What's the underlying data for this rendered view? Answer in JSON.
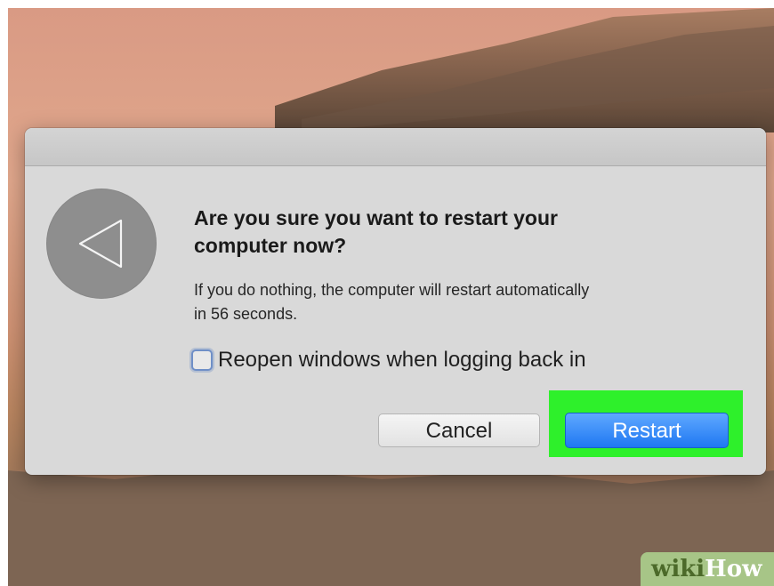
{
  "dialog": {
    "heading": "Are you sure you want to restart your\ncomputer now?",
    "message": "If you do nothing, the computer will restart automatically\nin 56 seconds.",
    "checkbox": {
      "label": "Reopen windows when logging back in",
      "checked": false
    },
    "cancel_label": "Cancel",
    "restart_label": "Restart",
    "icon": "back-triangle-icon"
  },
  "watermark": {
    "wiki": "wiki",
    "how": "How"
  },
  "colors": {
    "accent": "#2f86f6",
    "highlight": "#2ef02b",
    "dialog_bg": "#d9d9d9"
  }
}
